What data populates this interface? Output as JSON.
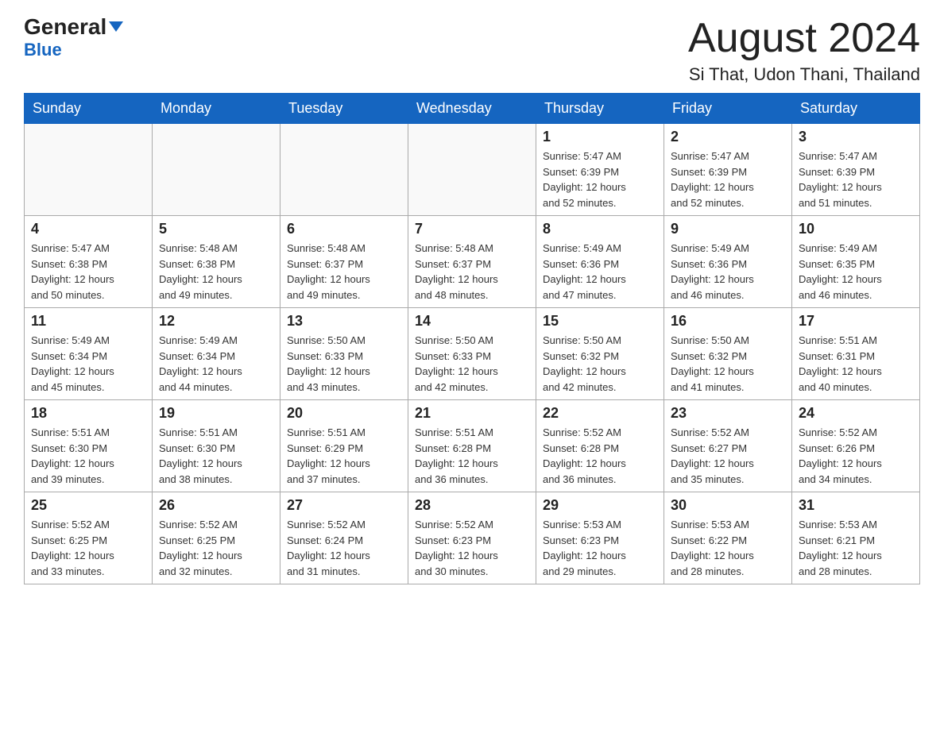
{
  "logo": {
    "general": "General",
    "triangle": "▲",
    "blue": "Blue"
  },
  "header": {
    "month": "August 2024",
    "location": "Si That, Udon Thani, Thailand"
  },
  "days": {
    "headers": [
      "Sunday",
      "Monday",
      "Tuesday",
      "Wednesday",
      "Thursday",
      "Friday",
      "Saturday"
    ]
  },
  "weeks": [
    [
      {
        "num": "",
        "info": ""
      },
      {
        "num": "",
        "info": ""
      },
      {
        "num": "",
        "info": ""
      },
      {
        "num": "",
        "info": ""
      },
      {
        "num": "1",
        "info": "Sunrise: 5:47 AM\nSunset: 6:39 PM\nDaylight: 12 hours\nand 52 minutes."
      },
      {
        "num": "2",
        "info": "Sunrise: 5:47 AM\nSunset: 6:39 PM\nDaylight: 12 hours\nand 52 minutes."
      },
      {
        "num": "3",
        "info": "Sunrise: 5:47 AM\nSunset: 6:39 PM\nDaylight: 12 hours\nand 51 minutes."
      }
    ],
    [
      {
        "num": "4",
        "info": "Sunrise: 5:47 AM\nSunset: 6:38 PM\nDaylight: 12 hours\nand 50 minutes."
      },
      {
        "num": "5",
        "info": "Sunrise: 5:48 AM\nSunset: 6:38 PM\nDaylight: 12 hours\nand 49 minutes."
      },
      {
        "num": "6",
        "info": "Sunrise: 5:48 AM\nSunset: 6:37 PM\nDaylight: 12 hours\nand 49 minutes."
      },
      {
        "num": "7",
        "info": "Sunrise: 5:48 AM\nSunset: 6:37 PM\nDaylight: 12 hours\nand 48 minutes."
      },
      {
        "num": "8",
        "info": "Sunrise: 5:49 AM\nSunset: 6:36 PM\nDaylight: 12 hours\nand 47 minutes."
      },
      {
        "num": "9",
        "info": "Sunrise: 5:49 AM\nSunset: 6:36 PM\nDaylight: 12 hours\nand 46 minutes."
      },
      {
        "num": "10",
        "info": "Sunrise: 5:49 AM\nSunset: 6:35 PM\nDaylight: 12 hours\nand 46 minutes."
      }
    ],
    [
      {
        "num": "11",
        "info": "Sunrise: 5:49 AM\nSunset: 6:34 PM\nDaylight: 12 hours\nand 45 minutes."
      },
      {
        "num": "12",
        "info": "Sunrise: 5:49 AM\nSunset: 6:34 PM\nDaylight: 12 hours\nand 44 minutes."
      },
      {
        "num": "13",
        "info": "Sunrise: 5:50 AM\nSunset: 6:33 PM\nDaylight: 12 hours\nand 43 minutes."
      },
      {
        "num": "14",
        "info": "Sunrise: 5:50 AM\nSunset: 6:33 PM\nDaylight: 12 hours\nand 42 minutes."
      },
      {
        "num": "15",
        "info": "Sunrise: 5:50 AM\nSunset: 6:32 PM\nDaylight: 12 hours\nand 42 minutes."
      },
      {
        "num": "16",
        "info": "Sunrise: 5:50 AM\nSunset: 6:32 PM\nDaylight: 12 hours\nand 41 minutes."
      },
      {
        "num": "17",
        "info": "Sunrise: 5:51 AM\nSunset: 6:31 PM\nDaylight: 12 hours\nand 40 minutes."
      }
    ],
    [
      {
        "num": "18",
        "info": "Sunrise: 5:51 AM\nSunset: 6:30 PM\nDaylight: 12 hours\nand 39 minutes."
      },
      {
        "num": "19",
        "info": "Sunrise: 5:51 AM\nSunset: 6:30 PM\nDaylight: 12 hours\nand 38 minutes."
      },
      {
        "num": "20",
        "info": "Sunrise: 5:51 AM\nSunset: 6:29 PM\nDaylight: 12 hours\nand 37 minutes."
      },
      {
        "num": "21",
        "info": "Sunrise: 5:51 AM\nSunset: 6:28 PM\nDaylight: 12 hours\nand 36 minutes."
      },
      {
        "num": "22",
        "info": "Sunrise: 5:52 AM\nSunset: 6:28 PM\nDaylight: 12 hours\nand 36 minutes."
      },
      {
        "num": "23",
        "info": "Sunrise: 5:52 AM\nSunset: 6:27 PM\nDaylight: 12 hours\nand 35 minutes."
      },
      {
        "num": "24",
        "info": "Sunrise: 5:52 AM\nSunset: 6:26 PM\nDaylight: 12 hours\nand 34 minutes."
      }
    ],
    [
      {
        "num": "25",
        "info": "Sunrise: 5:52 AM\nSunset: 6:25 PM\nDaylight: 12 hours\nand 33 minutes."
      },
      {
        "num": "26",
        "info": "Sunrise: 5:52 AM\nSunset: 6:25 PM\nDaylight: 12 hours\nand 32 minutes."
      },
      {
        "num": "27",
        "info": "Sunrise: 5:52 AM\nSunset: 6:24 PM\nDaylight: 12 hours\nand 31 minutes."
      },
      {
        "num": "28",
        "info": "Sunrise: 5:52 AM\nSunset: 6:23 PM\nDaylight: 12 hours\nand 30 minutes."
      },
      {
        "num": "29",
        "info": "Sunrise: 5:53 AM\nSunset: 6:23 PM\nDaylight: 12 hours\nand 29 minutes."
      },
      {
        "num": "30",
        "info": "Sunrise: 5:53 AM\nSunset: 6:22 PM\nDaylight: 12 hours\nand 28 minutes."
      },
      {
        "num": "31",
        "info": "Sunrise: 5:53 AM\nSunset: 6:21 PM\nDaylight: 12 hours\nand 28 minutes."
      }
    ]
  ]
}
